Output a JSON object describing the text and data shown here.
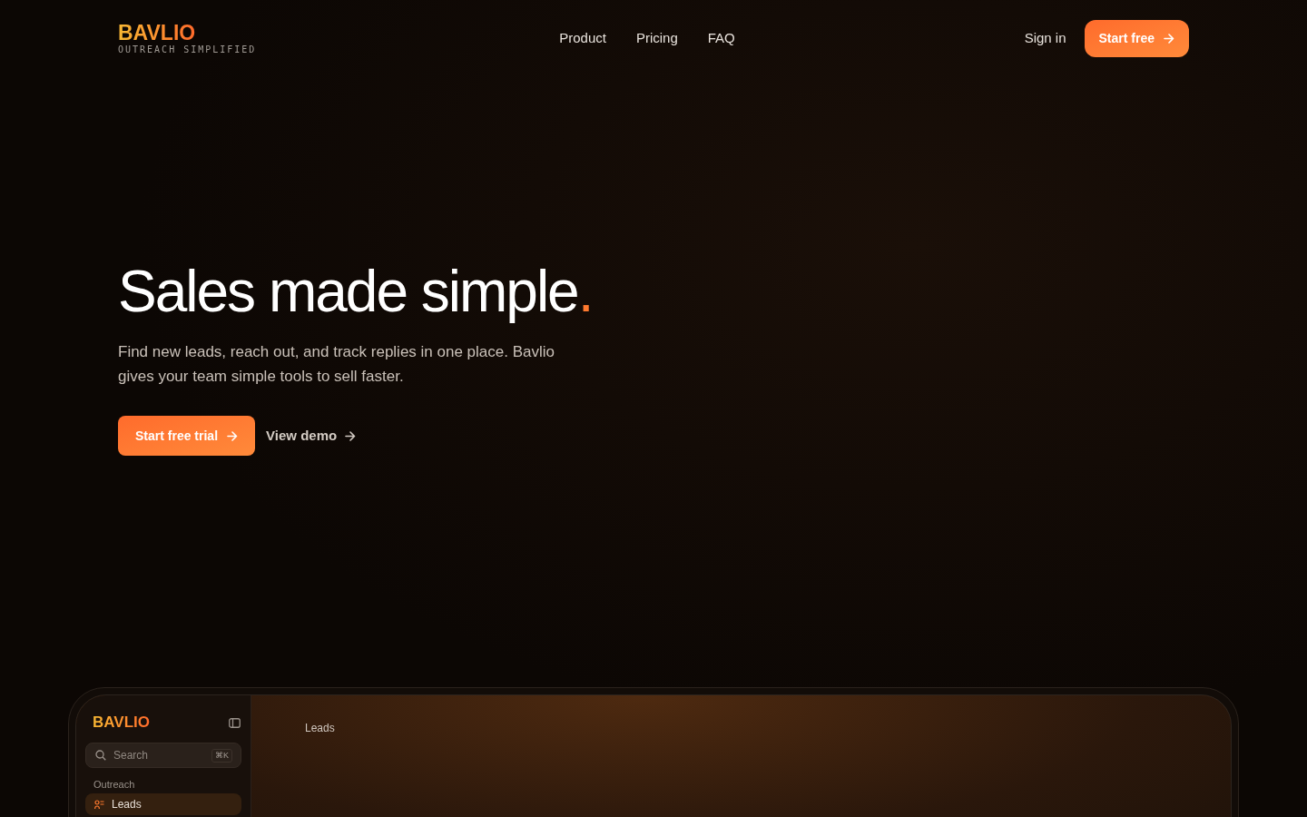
{
  "header": {
    "logo": "BAVLIO",
    "tagline": "OUTREACH SIMPLIFIED",
    "nav": [
      "Product",
      "Pricing",
      "FAQ"
    ],
    "sign_in": "Sign in",
    "cta": "Start free"
  },
  "hero": {
    "headline": "Sales made simple",
    "headline_period": ".",
    "description": "Find new leads, reach out, and track replies in one place. Bavlio gives your team simple tools to sell faster.",
    "primary_button": "Start free trial",
    "secondary_link": "View demo"
  },
  "app_preview": {
    "logo": "BAVLIO",
    "search": {
      "placeholder": "Search",
      "shortcut": "⌘K"
    },
    "sidebar_section": "Outreach",
    "sidebar_items": [
      {
        "label": "Leads",
        "selected": true
      }
    ],
    "page_title": "Leads"
  }
}
